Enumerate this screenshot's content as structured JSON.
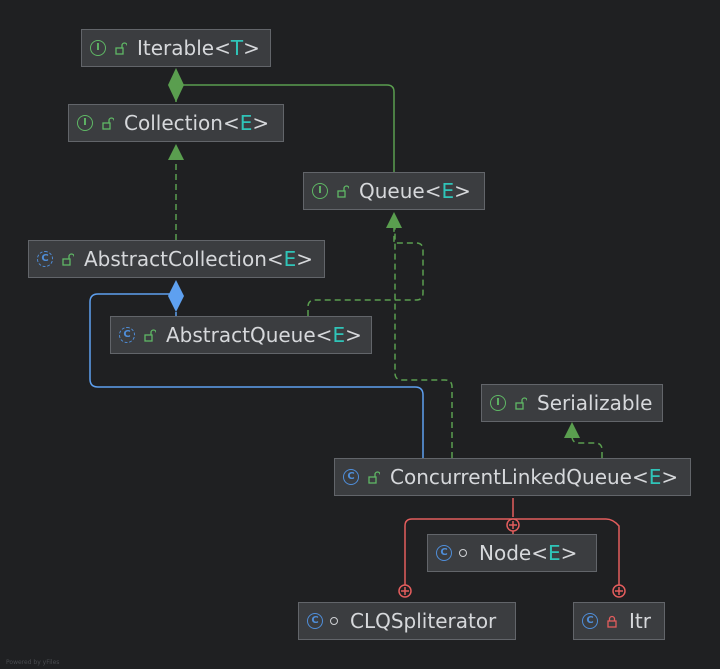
{
  "nodes": {
    "iterable": {
      "name": "Iterable",
      "open": "<",
      "param": "T",
      "close": ">",
      "kind": "interface",
      "badge": "I"
    },
    "collection": {
      "name": "Collection",
      "open": "<",
      "param": "E",
      "close": ">",
      "kind": "interface",
      "badge": "I"
    },
    "queue": {
      "name": "Queue",
      "open": "<",
      "param": "E",
      "close": ">",
      "kind": "interface",
      "badge": "I"
    },
    "abstract_collection": {
      "name": "AbstractCollection",
      "open": "<",
      "param": "E",
      "close": ">",
      "kind": "abstract-class",
      "badge": "C"
    },
    "abstract_queue": {
      "name": "AbstractQueue",
      "open": "<",
      "param": "E",
      "close": ">",
      "kind": "abstract-class",
      "badge": "C"
    },
    "serializable": {
      "name": "Serializable",
      "kind": "interface",
      "badge": "I"
    },
    "concurrent_linked_queue": {
      "name": "ConcurrentLinkedQueue",
      "open": "<",
      "param": "E",
      "close": ">",
      "kind": "class",
      "badge": "C"
    },
    "node": {
      "name": "Node",
      "open": "<",
      "param": "E",
      "close": ">",
      "kind": "static-class",
      "badge": "C"
    },
    "clq_spliterator": {
      "name": "CLQSpliterator",
      "kind": "static-class",
      "badge": "C"
    },
    "itr": {
      "name": "Itr",
      "kind": "private-class",
      "badge": "C"
    }
  },
  "colors": {
    "background": "#1f2022",
    "interface_arrow": "#5a9e4f",
    "extends_arrow": "#5ea0f0",
    "inner_class": "#e35d5d",
    "type_param": "#2fc4b8"
  },
  "footer": "Powered by yFiles"
}
